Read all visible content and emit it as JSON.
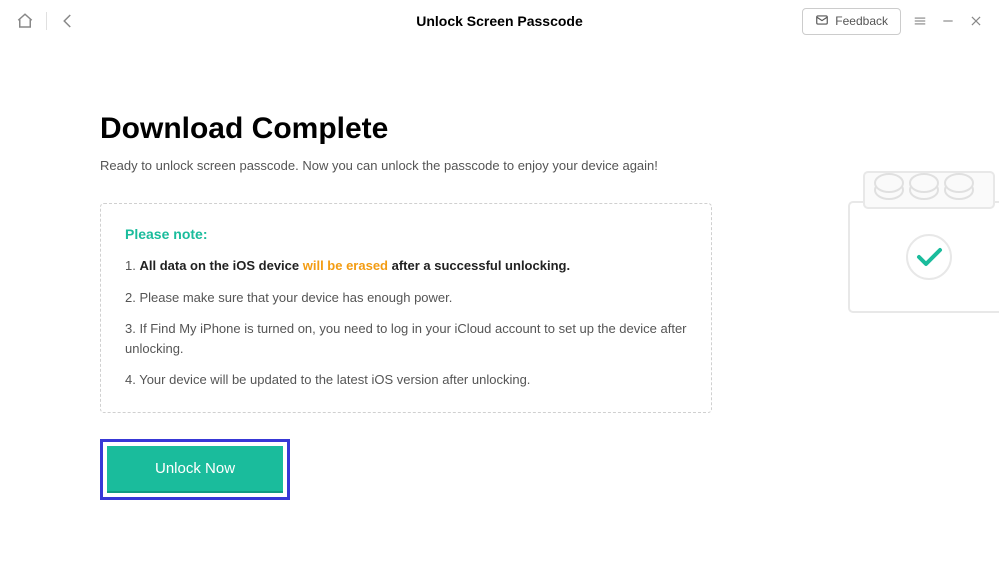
{
  "titlebar": {
    "title": "Unlock Screen Passcode",
    "feedback_label": "Feedback"
  },
  "main": {
    "heading": "Download Complete",
    "subtitle": "Ready to unlock screen passcode. Now you can unlock the passcode to enjoy your device again!",
    "note_heading": "Please note:",
    "notes": {
      "n1_prefix": "1. ",
      "n1_bold": "All data on the iOS device ",
      "n1_orange": "will be erased",
      "n1_suffix": " after a successful unlocking.",
      "n2": "2. Please make sure that your device has enough power.",
      "n3": "3. If Find My iPhone is turned on, you need to log in your iCloud account to set up the device after unlocking.",
      "n4": "4. Your device will be updated to the latest iOS version after unlocking."
    },
    "button_label": "Unlock Now"
  }
}
